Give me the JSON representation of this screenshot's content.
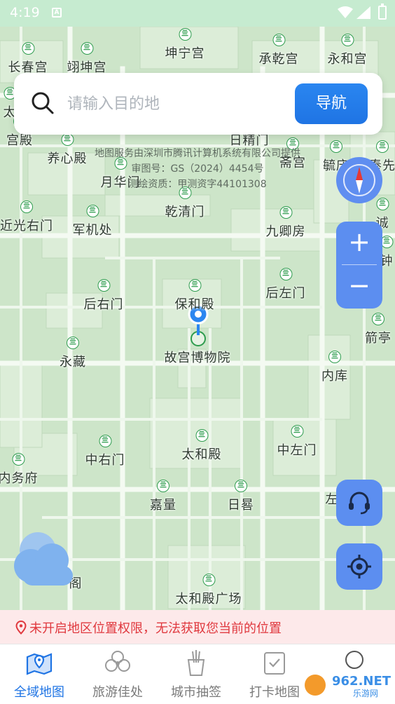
{
  "status_bar": {
    "time": "4:19",
    "notification_icon": "A"
  },
  "search": {
    "placeholder": "请输入目的地",
    "nav_button": "导航"
  },
  "map": {
    "notice_lines": [
      "地图服务由深圳市腾讯计算机系统有限公司提供",
      "审图号：GS（2024）4454号",
      "测绘资质：甲测资字44101308"
    ],
    "pois": [
      "坤宁宫",
      "长春宫",
      "翊坤宫",
      "承乾宫",
      "永和宫",
      "太",
      "宫殿",
      "养心殿",
      "日精门",
      "斋宫",
      "毓庆",
      "奉先",
      "月华门",
      "近光右门",
      "军机处",
      "乾清门",
      "九卿房",
      "诚",
      "后右门",
      "保和殿",
      "后左门",
      "钟",
      "故宫博物院",
      "箭亭",
      "永藏",
      "内库",
      "中右门",
      "太和殿",
      "中左门",
      "内务府",
      "嘉量",
      "日晷",
      "左",
      "阁",
      "太和殿广场"
    ],
    "poi_icon": "scenic-spot-icon"
  },
  "controls": {
    "compass_icon": "compass-icon",
    "zoom_in": "+",
    "zoom_out": "−",
    "support_icon": "headset-icon",
    "locate_icon": "locate-icon",
    "weather_icon": "cloud-icon"
  },
  "warning": {
    "text": "未开启地区位置权限，无法获取您当前的位置",
    "icon": "location-pin-icon"
  },
  "tabs": [
    {
      "label": "全域地图",
      "icon": "map-icon",
      "active": true
    },
    {
      "label": "旅游佳处",
      "icon": "flower-icon",
      "active": false
    },
    {
      "label": "城市抽签",
      "icon": "lottery-icon",
      "active": false
    },
    {
      "label": "打卡地图",
      "icon": "checkin-icon",
      "active": false
    },
    {
      "label": "",
      "icon": "profile-icon",
      "active": false
    }
  ],
  "watermark": {
    "text": "962.NET",
    "subtext": "乐游网"
  },
  "colors": {
    "accent": "#1f74e4",
    "map_green": "#cfe6cb",
    "warning": "#e0383e",
    "poi_green": "#2e9c4e"
  }
}
